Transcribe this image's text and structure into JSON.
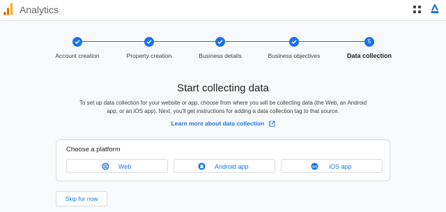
{
  "header": {
    "app_title": "Analytics",
    "icons": [
      "analytics-logo",
      "apps-grid-icon",
      "account-icon"
    ]
  },
  "stepper": {
    "steps": [
      {
        "label": "Account creation",
        "status": "done"
      },
      {
        "label": "Property creation",
        "status": "done"
      },
      {
        "label": "Business details",
        "status": "done"
      },
      {
        "label": "Business objectives",
        "status": "done"
      },
      {
        "label": "Data collection",
        "status": "current",
        "number": "5"
      }
    ]
  },
  "main": {
    "heading": "Start collecting data",
    "description": "To set up data collection for your website or app, choose from where you will be collecting data (the Web, an Android app, or an iOS app). Next, you'll get instructions for adding a data collection tag to that source.",
    "learn_link": "Learn more about data collection",
    "platform": {
      "title": "Choose a platform",
      "options": [
        {
          "label": "Web",
          "icon": "globe-icon"
        },
        {
          "label": "Android app",
          "icon": "android-icon"
        },
        {
          "label": "iOS app",
          "icon": "ios-icon"
        }
      ]
    },
    "skip_label": "Skip for now"
  },
  "colors": {
    "accent": "#1a73e8",
    "background": "#f8f9fa",
    "logo_orange": "#e37400",
    "logo_yellow": "#f9ab00"
  }
}
